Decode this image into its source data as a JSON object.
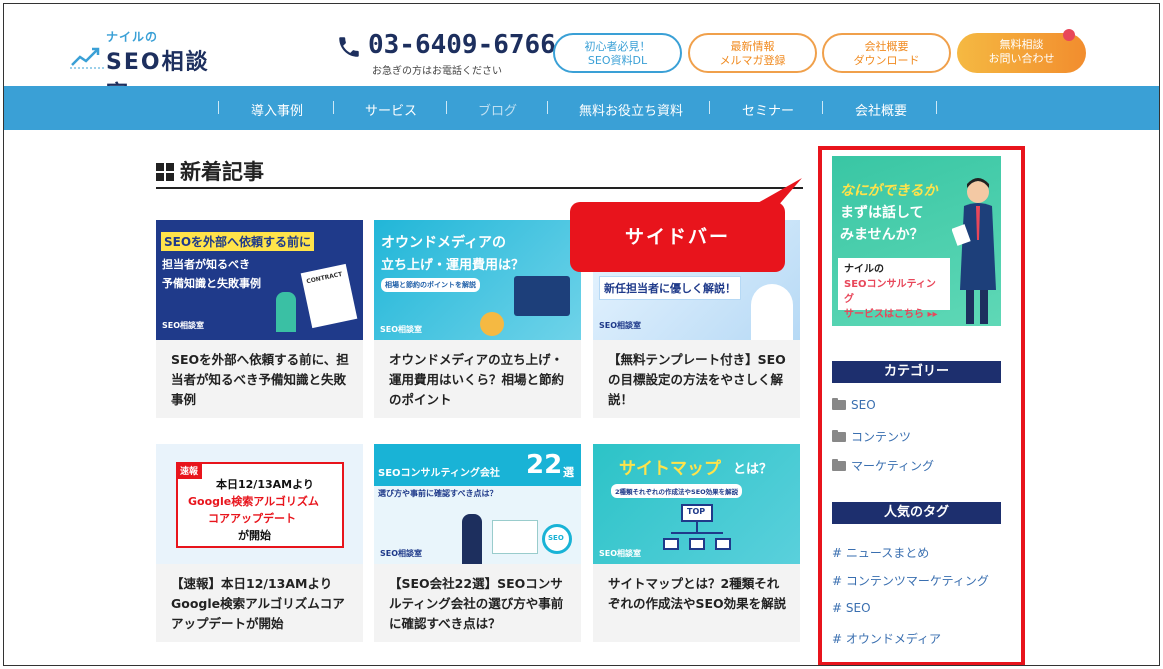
{
  "header": {
    "logo_small": "ナイルの",
    "logo_main": "SEO相談室",
    "phone_number": "03-6409-6766",
    "phone_note": "お急ぎの方はお電話ください",
    "buttons": [
      {
        "line1": "初心者必見！",
        "line2": "SEO資料DL"
      },
      {
        "line1": "最新情報",
        "line2": "メルマガ登録"
      },
      {
        "line1": "会社概要",
        "line2": "ダウンロード"
      },
      {
        "line1": "無料相談",
        "line2": "お問い合わせ"
      }
    ]
  },
  "nav": {
    "items": [
      "導入事例",
      "サービス",
      "ブログ",
      "無料お役立ち資料",
      "セミナー",
      "会社概要"
    ],
    "active_dim": "ブログ"
  },
  "main": {
    "section_title": "新着記事",
    "cards": [
      {
        "thumb_lines": [
          "SEOを外部へ依頼する前に",
          "担当者が知るべき",
          "予備知識と失敗事例"
        ],
        "thumb_logo": "SEO相談室",
        "thumb_sign": "CONTRACT",
        "title": "SEOを外部へ依頼する前に、担当者が知るべき予備知識と失敗事例"
      },
      {
        "thumb_lines": [
          "オウンドメディアの",
          "立ち上げ・運用費用は？",
          "相場と節約のポイントを解説"
        ],
        "thumb_logo": "SEO相談室",
        "thumb_sign": "",
        "title": "オウンドメディアの立ち上げ・運用費用はいくら？相場と節約のポイント"
      },
      {
        "thumb_lines": [
          "新任担当者に優しく解説！"
        ],
        "thumb_logo": "SEO相談室",
        "thumb_sign": "",
        "title": "【無料テンプレート付き】SEOの目標設定の方法をやさしく解説！"
      },
      {
        "thumb_lines": [
          "速報",
          "本日12/13AMより",
          "Google検索アルゴリズム",
          "コアアップデート",
          "が開始"
        ],
        "thumb_logo": "",
        "thumb_sign": "",
        "title": "【速報】本日12/13AMよりGoogle検索アルゴリズムコアアップデートが開始"
      },
      {
        "thumb_lines": [
          "SEOコンサルティング会社",
          "22",
          "選",
          "選び方や事前に確認すべき点は？"
        ],
        "thumb_logo": "SEO相談室",
        "thumb_sign": "SEO",
        "title": "【SEO会社22選】SEOコンサルティング会社の選び方や事前に確認すべき点は？"
      },
      {
        "thumb_lines": [
          "サイトマップ",
          "とは？",
          "2種類それぞれの作成法やSEO効果を解説",
          "TOP"
        ],
        "thumb_logo": "SEO相談室",
        "thumb_sign": "",
        "title": "サイトマップとは？2種類それぞれの作成法やSEO効果を解説"
      }
    ]
  },
  "callout": {
    "label": "サイドバー",
    "color": "#e8141c"
  },
  "sidebar": {
    "banner": {
      "line1": "なにができるか",
      "line2": "まずは話して",
      "line3": "みませんか？",
      "box_l1": "ナイルの",
      "box_l2": "SEOコンサルティング",
      "box_l3": "サービスはこちら ▸▸"
    },
    "category_title": "カテゴリー",
    "categories": [
      "SEO",
      "コンテンツ",
      "マーケティング"
    ],
    "tag_title": "人気のタグ",
    "tags": [
      "# ニュースまとめ",
      "# コンテンツマーケティング",
      "# SEO",
      "# オウンドメディア"
    ]
  },
  "colors": {
    "nav_bg": "#3aa0d6",
    "brand_navy": "#1d2f5e",
    "side_head_bg": "#1d2f6e",
    "highlight": "#e8141c"
  }
}
